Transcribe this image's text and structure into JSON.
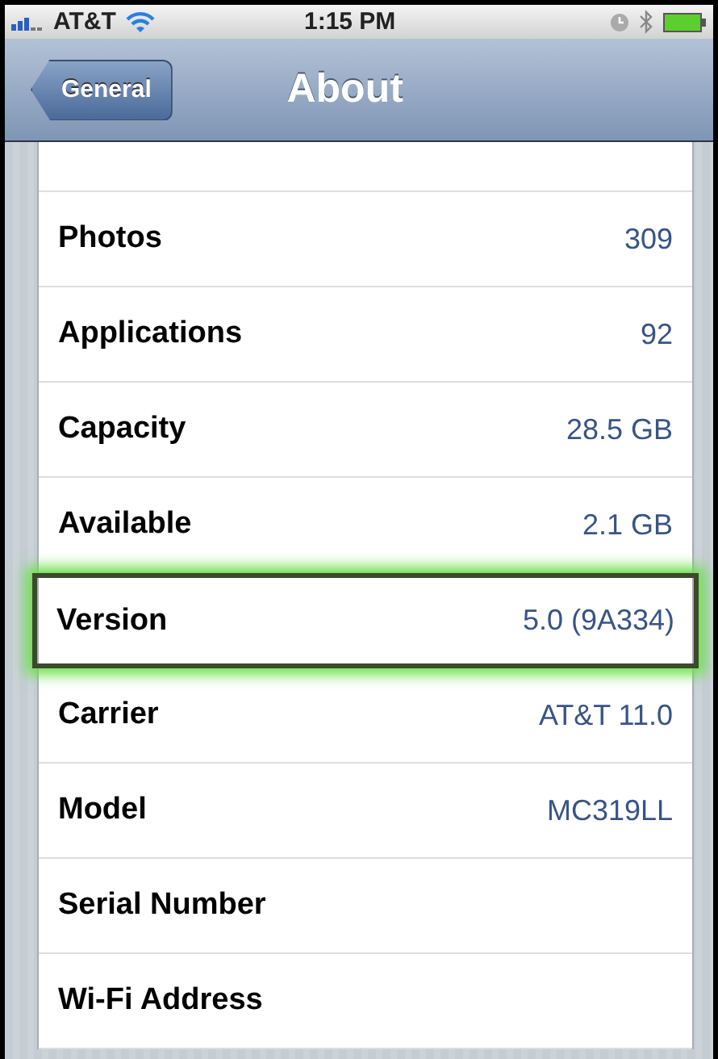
{
  "status_bar": {
    "carrier": "AT&T",
    "time": "1:15 PM"
  },
  "nav_bar": {
    "back_button": "General",
    "title": "About"
  },
  "rows": [
    {
      "label": "Photos",
      "value": "309",
      "highlighted": false
    },
    {
      "label": "Applications",
      "value": "92",
      "highlighted": false
    },
    {
      "label": "Capacity",
      "value": "28.5 GB",
      "highlighted": false
    },
    {
      "label": "Available",
      "value": "2.1 GB",
      "highlighted": false
    },
    {
      "label": "Version",
      "value": "5.0 (9A334)",
      "highlighted": true
    },
    {
      "label": "Carrier",
      "value": "AT&T 11.0",
      "highlighted": false
    },
    {
      "label": "Model",
      "value": "MC319LL",
      "highlighted": false
    },
    {
      "label": "Serial Number",
      "highlighted": false
    },
    {
      "label": "Wi-Fi Address",
      "highlighted": false
    }
  ]
}
